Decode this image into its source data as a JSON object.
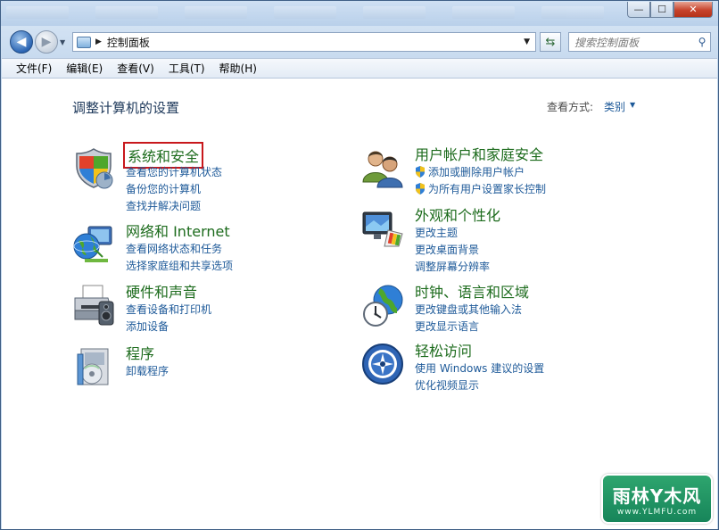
{
  "window": {
    "controls": {
      "minimize": "—",
      "maximize": "☐",
      "close": "✕"
    }
  },
  "nav": {
    "back_glyph": "◀",
    "forward_glyph": "▶",
    "address_sep": "▶",
    "address": "控制面板",
    "dropdown": "▼",
    "refresh": "⇆",
    "search_placeholder": "搜索控制面板",
    "search_glyph": "⚲"
  },
  "menu": [
    "文件(F)",
    "编辑(E)",
    "查看(V)",
    "工具(T)",
    "帮助(H)"
  ],
  "content": {
    "heading": "调整计算机的设置",
    "view_label": "查看方式:",
    "view_value": "类别",
    "view_arrow": "▼"
  },
  "categories": {
    "system": {
      "title": "系统和安全",
      "icon": "shield-icon",
      "links": [
        "查看您的计算机状态",
        "备份您的计算机",
        "查找并解决问题"
      ]
    },
    "network": {
      "title": "网络和 Internet",
      "icon": "globe-network-icon",
      "links": [
        "查看网络状态和任务",
        "选择家庭组和共享选项"
      ]
    },
    "hardware": {
      "title": "硬件和声音",
      "icon": "printer-icon",
      "links": [
        "查看设备和打印机",
        "添加设备"
      ]
    },
    "programs": {
      "title": "程序",
      "icon": "programs-icon",
      "links": [
        "卸载程序"
      ]
    },
    "users": {
      "title": "用户帐户和家庭安全",
      "icon": "users-icon",
      "links": [
        "添加或删除用户帐户",
        "为所有用户设置家长控制"
      ]
    },
    "appearance": {
      "title": "外观和个性化",
      "icon": "monitor-palette-icon",
      "links": [
        "更改主题",
        "更改桌面背景",
        "调整屏幕分辨率"
      ]
    },
    "clock": {
      "title": "时钟、语言和区域",
      "icon": "clock-globe-icon",
      "links": [
        "更改键盘或其他输入法",
        "更改显示语言"
      ]
    },
    "ease": {
      "title": "轻松访问",
      "icon": "ease-of-access-icon",
      "links": [
        "使用 Windows 建议的设置",
        "优化视频显示"
      ]
    }
  },
  "watermark": {
    "big": "雨林Y木风",
    "small": "www.YLMFU.com"
  },
  "colors": {
    "category_title": "#1c6b1c",
    "link": "#1e5a99",
    "highlight": "#c8181c"
  }
}
